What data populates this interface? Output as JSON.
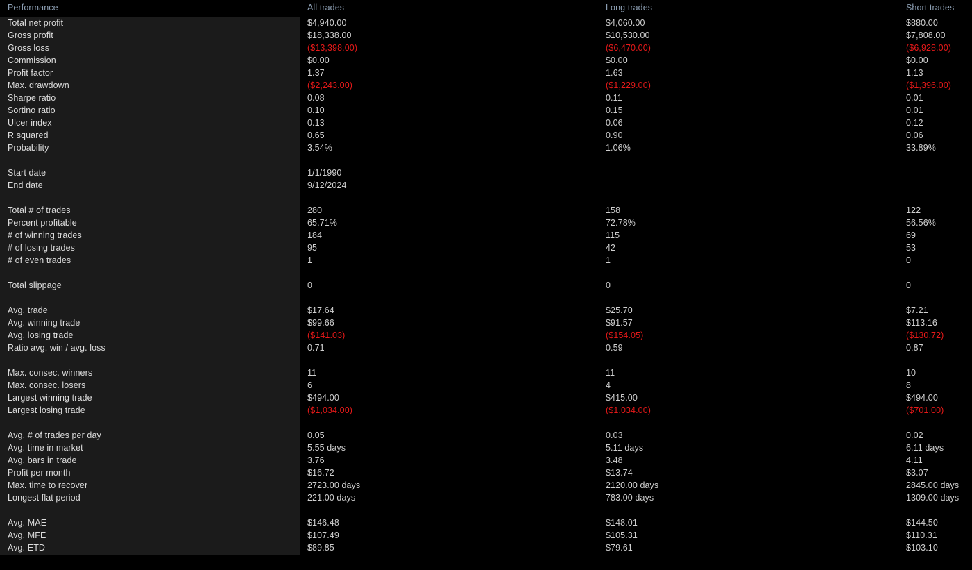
{
  "report": {
    "title": "Performance",
    "columns": {
      "label": "Performance",
      "all": "All trades",
      "long": "Long trades",
      "short": "Short trades"
    },
    "colors": {
      "background": "#000000",
      "label_panel": "#1b1b1b",
      "header_text": "#8d9fb3",
      "value_text": "#cfcfcf",
      "negative_text": "#e61919"
    },
    "groups": [
      {
        "rows": [
          {
            "label": "Total net profit",
            "all": "$4,940.00",
            "long": "$4,060.00",
            "short": "$880.00",
            "neg": false
          },
          {
            "label": "Gross profit",
            "all": "$18,338.00",
            "long": "$10,530.00",
            "short": "$7,808.00",
            "neg": false
          },
          {
            "label": "Gross loss",
            "all": "($13,398.00)",
            "long": "($6,470.00)",
            "short": "($6,928.00)",
            "neg": true
          },
          {
            "label": "Commission",
            "all": "$0.00",
            "long": "$0.00",
            "short": "$0.00",
            "neg": false
          },
          {
            "label": "Profit factor",
            "all": "1.37",
            "long": "1.63",
            "short": "1.13",
            "neg": false
          },
          {
            "label": "Max. drawdown",
            "all": "($2,243.00)",
            "long": "($1,229.00)",
            "short": "($1,396.00)",
            "neg": true
          },
          {
            "label": "Sharpe ratio",
            "all": "0.08",
            "long": "0.11",
            "short": "0.01",
            "neg": false
          },
          {
            "label": "Sortino ratio",
            "all": "0.10",
            "long": "0.15",
            "short": "0.01",
            "neg": false
          },
          {
            "label": "Ulcer index",
            "all": "0.13",
            "long": "0.06",
            "short": "0.12",
            "neg": false
          },
          {
            "label": "R squared",
            "all": "0.65",
            "long": "0.90",
            "short": "0.06",
            "neg": false
          },
          {
            "label": "Probability",
            "all": "3.54%",
            "long": "1.06%",
            "short": "33.89%",
            "neg": false
          }
        ]
      },
      {
        "rows": [
          {
            "label": "Start date",
            "all": "1/1/1990",
            "long": "",
            "short": "",
            "neg": false
          },
          {
            "label": "End date",
            "all": "9/12/2024",
            "long": "",
            "short": "",
            "neg": false
          }
        ]
      },
      {
        "rows": [
          {
            "label": "Total # of trades",
            "all": "280",
            "long": "158",
            "short": "122",
            "neg": false
          },
          {
            "label": "Percent profitable",
            "all": "65.71%",
            "long": "72.78%",
            "short": "56.56%",
            "neg": false
          },
          {
            "label": "# of winning trades",
            "all": "184",
            "long": "115",
            "short": "69",
            "neg": false
          },
          {
            "label": "# of losing trades",
            "all": "95",
            "long": "42",
            "short": "53",
            "neg": false
          },
          {
            "label": "# of even trades",
            "all": "1",
            "long": "1",
            "short": "0",
            "neg": false
          }
        ]
      },
      {
        "rows": [
          {
            "label": "Total slippage",
            "all": "0",
            "long": "0",
            "short": "0",
            "neg": false
          }
        ]
      },
      {
        "rows": [
          {
            "label": "Avg. trade",
            "all": "$17.64",
            "long": "$25.70",
            "short": "$7.21",
            "neg": false
          },
          {
            "label": "Avg. winning trade",
            "all": "$99.66",
            "long": "$91.57",
            "short": "$113.16",
            "neg": false
          },
          {
            "label": "Avg. losing trade",
            "all": "($141.03)",
            "long": "($154.05)",
            "short": "($130.72)",
            "neg": true
          },
          {
            "label": "Ratio avg. win / avg. loss",
            "all": "0.71",
            "long": "0.59",
            "short": "0.87",
            "neg": false
          }
        ]
      },
      {
        "rows": [
          {
            "label": "Max. consec. winners",
            "all": "11",
            "long": "11",
            "short": "10",
            "neg": false
          },
          {
            "label": "Max. consec. losers",
            "all": "6",
            "long": "4",
            "short": "8",
            "neg": false
          },
          {
            "label": "Largest winning trade",
            "all": "$494.00",
            "long": "$415.00",
            "short": "$494.00",
            "neg": false
          },
          {
            "label": "Largest losing trade",
            "all": "($1,034.00)",
            "long": "($1,034.00)",
            "short": "($701.00)",
            "neg": true
          }
        ]
      },
      {
        "rows": [
          {
            "label": "Avg. # of trades per day",
            "all": "0.05",
            "long": "0.03",
            "short": "0.02",
            "neg": false
          },
          {
            "label": "Avg. time in market",
            "all": "5.55 days",
            "long": "5.11 days",
            "short": "6.11 days",
            "neg": false
          },
          {
            "label": "Avg. bars in trade",
            "all": "3.76",
            "long": "3.48",
            "short": "4.11",
            "neg": false
          },
          {
            "label": "Profit per month",
            "all": "$16.72",
            "long": "$13.74",
            "short": "$3.07",
            "neg": false
          },
          {
            "label": "Max. time to recover",
            "all": "2723.00 days",
            "long": "2120.00 days",
            "short": "2845.00 days",
            "neg": false
          },
          {
            "label": "Longest flat period",
            "all": "221.00 days",
            "long": "783.00 days",
            "short": "1309.00 days",
            "neg": false
          }
        ]
      },
      {
        "rows": [
          {
            "label": "Avg. MAE",
            "all": "$146.48",
            "long": "$148.01",
            "short": "$144.50",
            "neg": false
          },
          {
            "label": "Avg. MFE",
            "all": "$107.49",
            "long": "$105.31",
            "short": "$110.31",
            "neg": false
          },
          {
            "label": "Avg. ETD",
            "all": "$89.85",
            "long": "$79.61",
            "short": "$103.10",
            "neg": false
          }
        ]
      }
    ]
  }
}
